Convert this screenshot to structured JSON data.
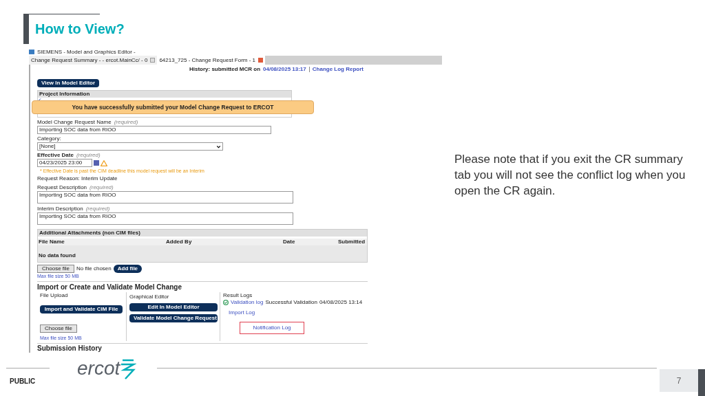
{
  "slide": {
    "title": "How to View?",
    "note": "Please note that if you exit the CR summary tab you will not see the conflict log when you open the CR again.",
    "footer": {
      "classification": "PUBLIC",
      "logo": "ercot",
      "page": "7"
    }
  },
  "app": {
    "window_title": "SIEMENS - Model and Graphics Editor -",
    "tabs": [
      {
        "label": "Change Request Summary - - ercot.MainCc/ - 0",
        "selected": false
      },
      {
        "label": "64213_725 - Change Request Form - 1",
        "selected": true
      }
    ],
    "history": {
      "label": "History: submitted MCR on",
      "date": "04/08/2025 13:17",
      "link": "Change Log Report"
    },
    "view_button": "View In Model Editor",
    "project_section": "Project Information",
    "toast": "You have successfully submitted your Model Change Request to ERCOT",
    "fields": [
      {
        "kind": "input",
        "label": "Model Change Request Name",
        "hint": "(required)",
        "value": "Importing SOC data from RIOO"
      },
      {
        "kind": "select",
        "label": "Category:",
        "value": "[None]"
      },
      {
        "kind": "date",
        "label": "Effective Date",
        "hint": "(required)",
        "value": "04/23/2025 23:00",
        "warning": "* Effective Date is past the CIM deadline this model request will be an Interim"
      },
      {
        "kind": "text",
        "label": "Request Reason: Interim Update"
      },
      {
        "kind": "textarea",
        "label": "Request Description",
        "hint": "(required)",
        "value": "Importing SOC data from RIOO"
      },
      {
        "kind": "textarea",
        "label": "Interim Description",
        "hint": "(required)",
        "value": "Importing SOC data from RIOO"
      }
    ],
    "attachments": {
      "title": "Additional Attachments (non CIM files)",
      "columns": [
        "File Name",
        "Added By",
        "Date",
        "Submitted"
      ],
      "empty": "No data found",
      "choose": "Choose file",
      "no_file": "No file chosen",
      "add": "Add file",
      "max": "Max file size 50 MB"
    },
    "import": {
      "title": "Import or Create and Validate Model Change",
      "upload": {
        "label": "File Upload",
        "button": "Import and Validate CIM File",
        "choose": "Choose file",
        "max": "Max file size 50 MB"
      },
      "editor": {
        "label": "Graphical Editor",
        "buttons": [
          "Edit In Model Editor",
          "Validate Model Change Request"
        ]
      },
      "logs": {
        "label": "Result Logs",
        "validation_link": "Validation log",
        "status": "Successful Validation",
        "date": "04/08/2025 13:14",
        "import_link": "Import Log",
        "notification_link": "Notification Log"
      }
    },
    "next_section": "Submission History"
  }
}
